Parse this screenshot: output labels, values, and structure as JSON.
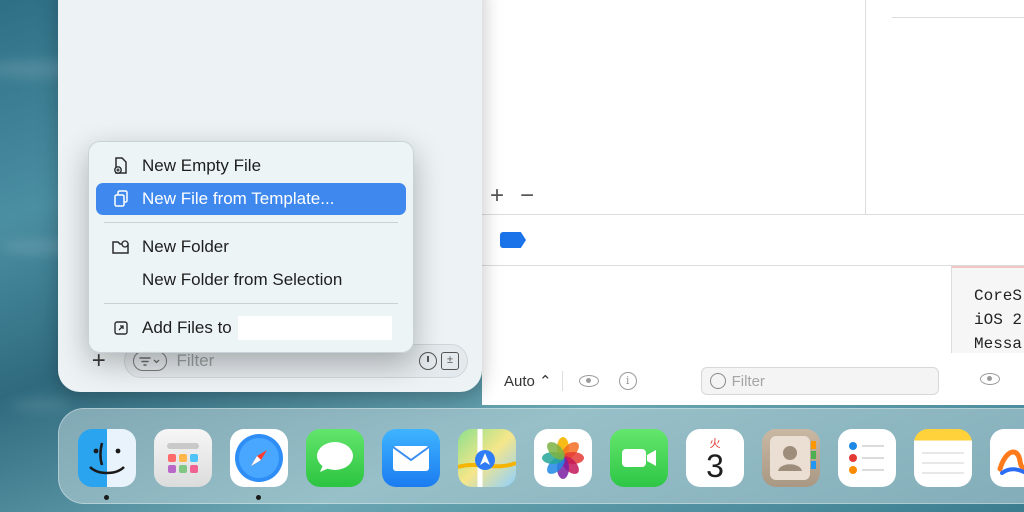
{
  "context_menu": {
    "items": [
      {
        "label": "New Empty File",
        "icon": "doc-badge-plus-icon",
        "selected": false
      },
      {
        "label": "New File from Template...",
        "icon": "doc-on-doc-icon",
        "selected": true
      },
      {
        "label": "New Folder",
        "icon": "folder-badge-plus-icon",
        "selected": false
      },
      {
        "label": "New Folder from Selection",
        "icon": "",
        "selected": false
      },
      {
        "label": "Add Files to",
        "icon": "square-arrow-up-right-icon",
        "selected": false
      }
    ]
  },
  "navigator": {
    "add_button": "+",
    "filter_placeholder": "Filter"
  },
  "editor": {
    "add_symbol": "+",
    "remove_symbol": "−",
    "console_lines": [
      "CoreS",
      "iOS 2",
      "Messa"
    ]
  },
  "debug_bar": {
    "variables_scope": "Auto ⌃",
    "filter_placeholder": "Filter",
    "info_glyph": "i"
  },
  "dock": {
    "apps": [
      {
        "name": "Finder",
        "running": true
      },
      {
        "name": "Launchpad",
        "running": false
      },
      {
        "name": "Safari",
        "running": true
      },
      {
        "name": "Messages",
        "running": false
      },
      {
        "name": "Mail",
        "running": false
      },
      {
        "name": "Maps",
        "running": false
      },
      {
        "name": "Photos",
        "running": false
      },
      {
        "name": "FaceTime",
        "running": false
      },
      {
        "name": "Calendar",
        "running": false
      },
      {
        "name": "Contacts",
        "running": false
      },
      {
        "name": "Reminders",
        "running": false
      },
      {
        "name": "Notes",
        "running": false
      },
      {
        "name": "Freeform",
        "running": false
      }
    ],
    "calendar": {
      "weekday": "火",
      "day": "3"
    }
  },
  "colors": {
    "selection": "#3f88ee",
    "breakpoint": "#1a73e8"
  }
}
